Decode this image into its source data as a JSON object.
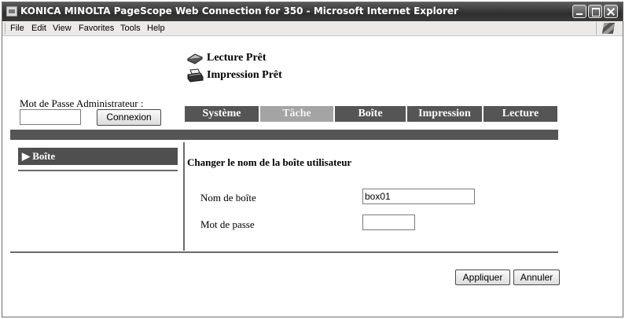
{
  "window": {
    "title": "KONICA MINOLTA PageScope Web Connection for 350 - Microsoft Internet Explorer"
  },
  "menubar": {
    "items": [
      "File",
      "Edit",
      "View",
      "Favorites",
      "Tools",
      "Help"
    ]
  },
  "status": {
    "scan": "Lecture Prêt",
    "print": "Impression Prêt"
  },
  "admin": {
    "label": "Mot de Passe Administrateur :",
    "password_value": "",
    "login_label": "Connexion"
  },
  "tabs": [
    {
      "label": "Système"
    },
    {
      "label": "Tâche"
    },
    {
      "label": "Boîte"
    },
    {
      "label": "Impression"
    },
    {
      "label": "Lecture"
    }
  ],
  "sidebar": {
    "items": [
      {
        "label": "▶ Boîte"
      }
    ]
  },
  "form": {
    "title": "Changer le nom de la boîte utilisateur",
    "box_name_label": "Nom de boîte",
    "box_name_value": "box01",
    "password_label": "Mot de passe",
    "password_value": ""
  },
  "buttons": {
    "apply": "Appliquer",
    "cancel": "Annuler"
  },
  "colors": {
    "tab_dark": "#555555",
    "tab_inactive": "#a4a4a4",
    "sidebar_active": "#4f4f4f"
  }
}
